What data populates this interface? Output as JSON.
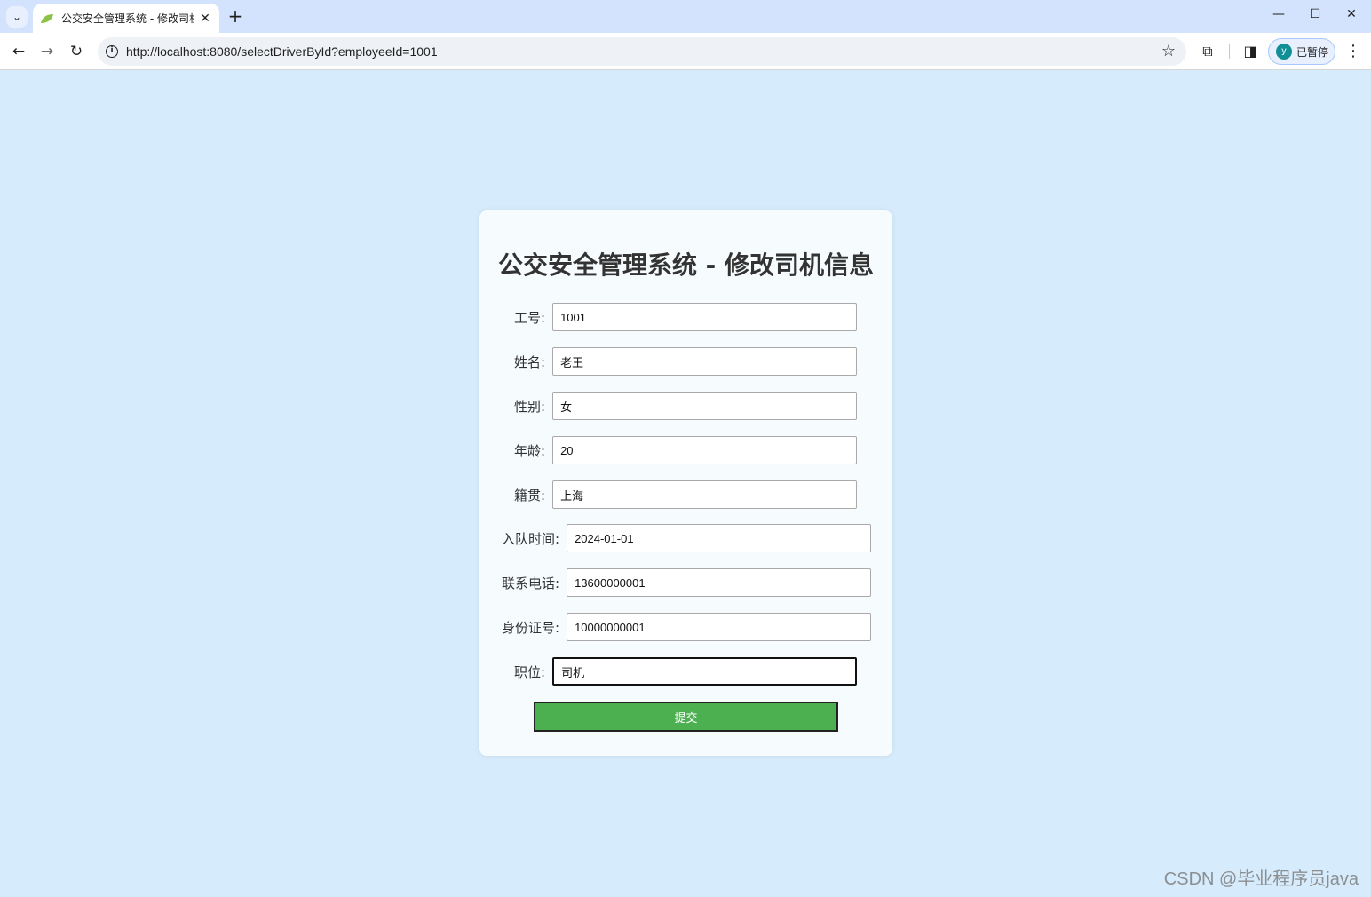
{
  "browser": {
    "tab_title": "公交安全管理系统 - 修改司机信",
    "tab_close": "✕",
    "new_tab": "+",
    "url": "http://localhost:8080/selectDriverById?employeeId=1001",
    "profile_initial": "y",
    "profile_label": "已暂停",
    "window": {
      "minimize": "—",
      "maximize": "☐",
      "close": "✕"
    },
    "icons": {
      "tab_search": "chevron-down-icon",
      "back": "arrow-left-icon",
      "forward": "arrow-right-icon",
      "reload": "reload-icon",
      "site_info": "info-icon",
      "bookmark": "star-icon",
      "extensions": "puzzle-icon",
      "side_panel": "side-panel-icon",
      "menu": "kebab-menu-icon"
    }
  },
  "page": {
    "title": "公交安全管理系统 - 修改司机信息",
    "fields": [
      {
        "label": "工号:",
        "value": "1001"
      },
      {
        "label": "姓名:",
        "value": "老王"
      },
      {
        "label": "性别:",
        "value": "女"
      },
      {
        "label": "年龄:",
        "value": "20"
      },
      {
        "label": "籍贯:",
        "value": "上海"
      },
      {
        "label": "入队时间:",
        "value": "2024-01-01"
      },
      {
        "label": "联系电话:",
        "value": "13600000001"
      },
      {
        "label": "身份证号:",
        "value": "10000000001"
      },
      {
        "label": "职位:",
        "value": "司机"
      }
    ],
    "submit_label": "提交",
    "accent_color": "#4caf50",
    "background_color": "#d6ebfb"
  },
  "watermark": "CSDN @毕业程序员java"
}
